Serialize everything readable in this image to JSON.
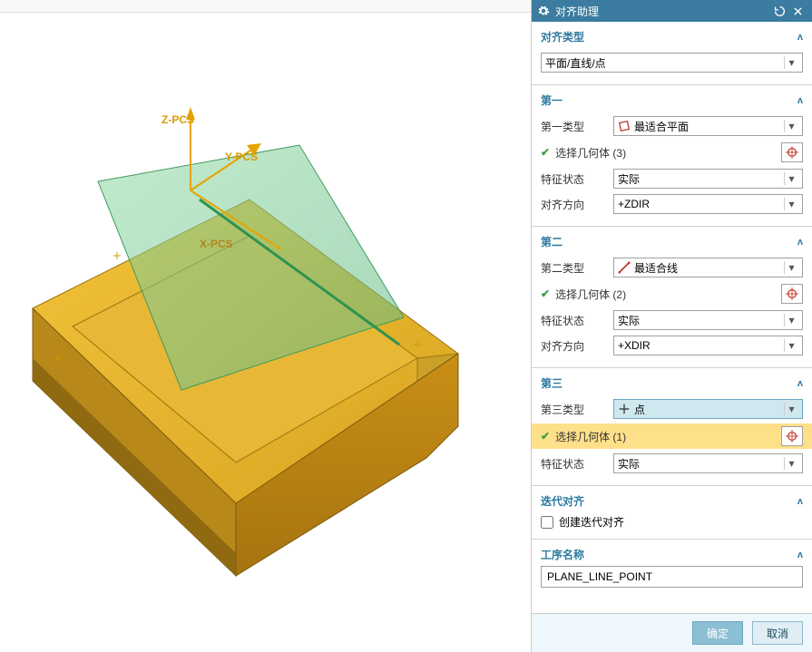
{
  "panel": {
    "title": "对齐助理",
    "align_type": {
      "header": "对齐类型",
      "value": "平面/直线/点"
    },
    "first": {
      "header": "第一",
      "type_label": "第一类型",
      "type_value": "最适合平面",
      "geom_text": "选择几何体 (3)",
      "feat_label": "特征状态",
      "feat_value": "实际",
      "dir_label": "对齐方向",
      "dir_value": "+ZDIR"
    },
    "second": {
      "header": "第二",
      "type_label": "第二类型",
      "type_value": "最适合线",
      "geom_text": "选择几何体 (2)",
      "feat_label": "特征状态",
      "feat_value": "实际",
      "dir_label": "对齐方向",
      "dir_value": "+XDIR"
    },
    "third": {
      "header": "第三",
      "type_label": "第三类型",
      "type_value": "点",
      "geom_text": "选择几何体 (1)",
      "feat_label": "特征状态",
      "feat_value": "实际"
    },
    "iterative": {
      "header": "迭代对齐",
      "checkbox_label": "创建迭代对齐"
    },
    "process_name": {
      "header": "工序名称",
      "value": "PLANE_LINE_POINT"
    }
  },
  "footer": {
    "ok": "确定",
    "cancel": "取消"
  },
  "viewport": {
    "z_axis": "Z-PCS",
    "y_axis": "Y-PCS",
    "x_axis": "X-PCS"
  }
}
